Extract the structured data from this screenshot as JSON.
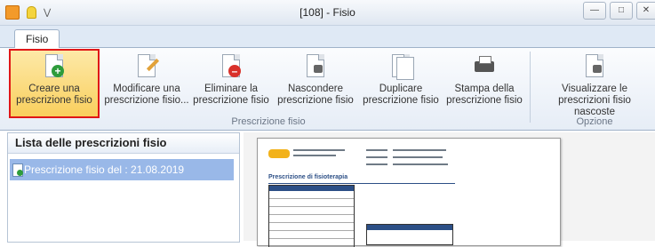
{
  "window": {
    "title": "[108] - Fisio",
    "quick_access_arrow": "⋁",
    "buttons": {
      "minimize": "—",
      "maximize": "□",
      "close": "✕"
    }
  },
  "tabs": [
    {
      "label": "Fisio",
      "active": true
    }
  ],
  "ribbon": {
    "groups": [
      {
        "label": "Prescrizione fisio",
        "buttons": [
          {
            "line1": "Creare una",
            "line2": "prescrizione fisio",
            "icon": "add-document-icon",
            "selected": true
          },
          {
            "line1": "Modificare una",
            "line2": "prescrizione fisio...",
            "icon": "edit-document-icon"
          },
          {
            "line1": "Eliminare la",
            "line2": "prescrizione fisio",
            "icon": "delete-document-icon"
          },
          {
            "line1": "Nascondere",
            "line2": "prescrizione fisio",
            "icon": "hide-document-icon"
          },
          {
            "line1": "Duplicare",
            "line2": "prescrizione fisio",
            "icon": "duplicate-document-icon"
          },
          {
            "line1": "Stampa della",
            "line2": "prescrizione fisio",
            "icon": "printer-icon"
          }
        ]
      },
      {
        "label": "Opzione",
        "buttons": [
          {
            "line1": "Visualizzare le",
            "line2": "prescrizioni fisio nascoste",
            "icon": "show-hidden-icon"
          }
        ]
      }
    ]
  },
  "list_panel": {
    "title": "Lista delle prescrizioni fisio",
    "items": [
      {
        "label": "Prescrizione fisio del : 21.08.2019",
        "selected": true
      }
    ]
  },
  "preview": {
    "title": "Prescrizione di fisioterapia"
  },
  "colors": {
    "selected_item": "#99b8e8",
    "selected_button": "#f9cf5d",
    "highlight_border": "#e01717",
    "add_badge": "#2e9c3b",
    "delete_badge": "#d9312b"
  }
}
